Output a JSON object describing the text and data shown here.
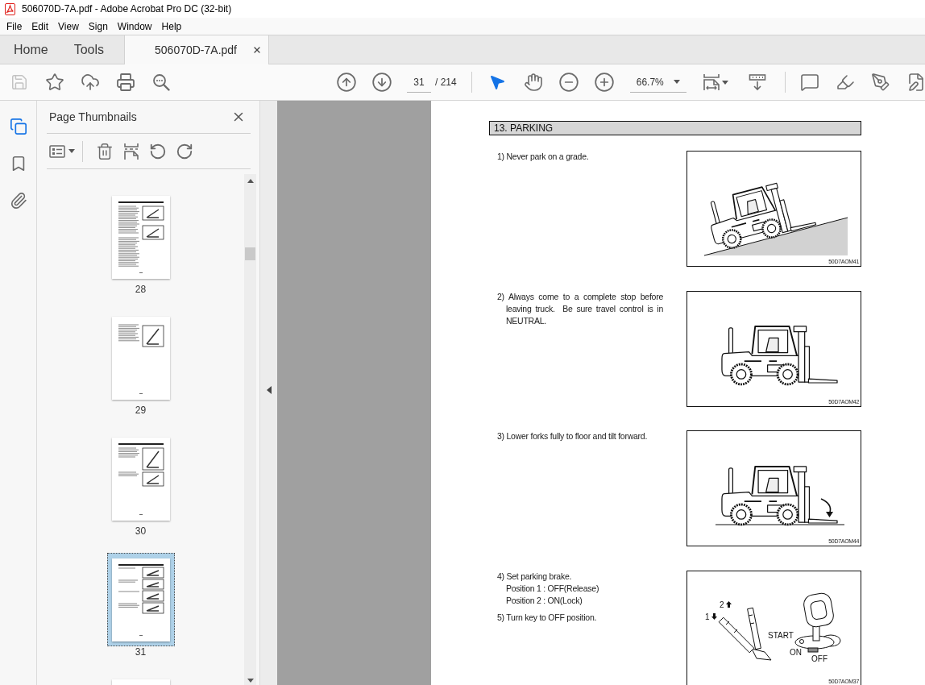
{
  "window": {
    "title": "506070D-7A.pdf - Adobe Acrobat Pro DC (32-bit)"
  },
  "menu_bar": [
    {
      "label": "File"
    },
    {
      "label": "Edit"
    },
    {
      "label": "View"
    },
    {
      "label": "Sign"
    },
    {
      "label": "Window"
    },
    {
      "label": "Help"
    }
  ],
  "tabs": [
    {
      "label": "Home",
      "kind": "nav",
      "selected": false
    },
    {
      "label": "Tools",
      "kind": "nav",
      "selected": false
    },
    {
      "label": "506070D-7A.pdf",
      "kind": "document",
      "selected": true
    }
  ],
  "toolbar": {
    "file_tools": [
      {
        "kind": "save",
        "disabled": true
      },
      {
        "kind": "star",
        "disabled": false
      },
      {
        "kind": "upload",
        "disabled": false
      },
      {
        "kind": "print",
        "disabled": false
      },
      {
        "kind": "find",
        "disabled": false
      }
    ],
    "page_number": "31",
    "page_total": "/ 214",
    "view_tools": [
      {
        "kind": "select",
        "selected": true
      },
      {
        "kind": "hand",
        "selected": false
      }
    ],
    "zoom": "66.7%"
  },
  "nav_rail": [
    {
      "kind": "pages",
      "selected": true
    },
    {
      "kind": "bookmarks",
      "selected": false
    },
    {
      "kind": "attachments",
      "selected": false
    }
  ],
  "thumbnails_panel": {
    "title": "Page Thumbnails",
    "pages": [
      {
        "label": "28",
        "selected": false
      },
      {
        "label": "29",
        "selected": false
      },
      {
        "label": "30",
        "selected": false
      },
      {
        "label": "31",
        "selected": true
      },
      {
        "selected": false
      }
    ]
  },
  "document": {
    "section_title": "13. PARKING",
    "items": [
      {
        "steps": [
          {
            "text": "1) Never park on a grade."
          }
        ],
        "figure": {
          "kind": "forklift-on-slope",
          "code": "50D7AOM41"
        }
      },
      {
        "steps": [
          {
            "text": "2) Always come to a complete stop before leaving truck.  Be sure travel control is in NEUTRAL."
          }
        ],
        "figure": {
          "kind": "forklift",
          "code": "50D7AOM42"
        }
      },
      {
        "steps": [
          {
            "text": "3) Lower forks fully to floor and tilt forward."
          }
        ],
        "figure": {
          "kind": "forklift-tilt",
          "code": "50D7AOM44"
        }
      },
      {
        "steps": [
          {
            "text": "4) Set parking brake.",
            "children": [
              {
                "text": "Position 1 : OFF(Release)"
              },
              {
                "text": "Position 2 : ON(Lock)"
              }
            ]
          },
          {
            "text": "5) Turn key to OFF position."
          }
        ],
        "figure": {
          "kind": "brake-and-key",
          "code": "50D7AOM37",
          "labels": [
            {
              "text": "2",
              "kind": "up"
            },
            {
              "text": "1",
              "kind": "down"
            },
            {
              "text": "START",
              "kind": "plain"
            },
            {
              "text": "ON",
              "kind": "plain"
            },
            {
              "text": "OFF",
              "kind": "plain"
            }
          ]
        }
      }
    ]
  }
}
